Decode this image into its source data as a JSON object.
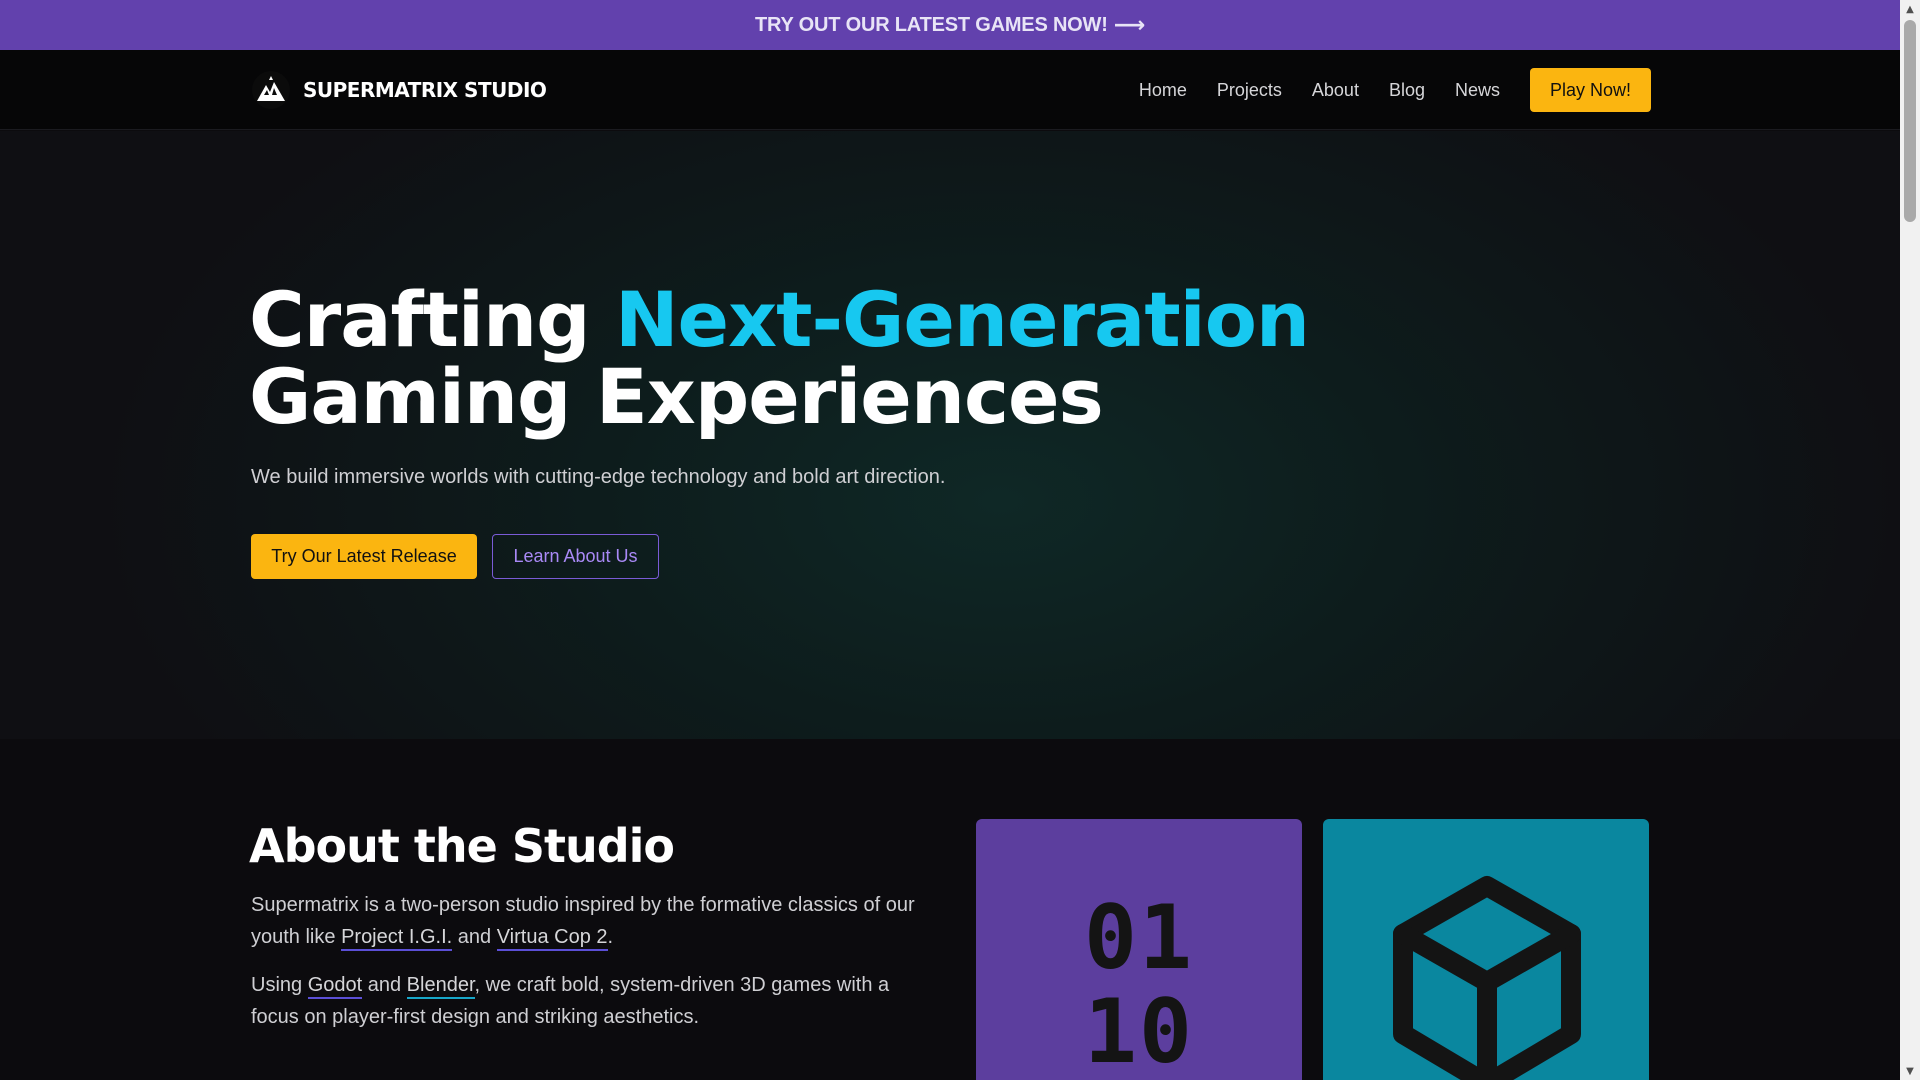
{
  "announcement": {
    "text": "TRY OUT OUR LATEST GAMES NOW!",
    "arrow": "⟶"
  },
  "navbar": {
    "brand": "SUPERMATRIX STUDIO",
    "logo_icon": "mountain-logo-icon",
    "links": [
      "Home",
      "Projects",
      "About",
      "Blog",
      "News"
    ],
    "cta": "Play Now!"
  },
  "hero": {
    "title_start": "Crafting ",
    "title_accent": "Next-Generation",
    "title_line2": "Gaming Experiences",
    "subtitle": "We build immersive worlds with cutting-edge technology and bold art direction.",
    "primary_button": "Try Our Latest Release",
    "secondary_button": "Learn About Us"
  },
  "about": {
    "title": "About the Studio",
    "p1_start": "Supermatrix is a two-person studio inspired by the formative classics of our youth like ",
    "p1_link1": "Project I.G.I.",
    "p1_mid": " and ",
    "p1_link2": "Virtua Cop 2",
    "p1_end": ".",
    "p2_start": "Using ",
    "p2_link1": "Godot",
    "p2_mid": " and ",
    "p2_link2": "Blender",
    "p2_end": ", we craft bold, system-driven 3D games with a focus on player-first design and striking aesthetics.",
    "binary_line1": "01",
    "binary_line2": "10",
    "cube_icon": "cube-icon"
  },
  "colors": {
    "announcement_bg": "#6241ad",
    "accent_cyan": "#17c8f0",
    "button_yellow": "#fbb510",
    "card_purple": "#5c3e9e",
    "card_teal": "#0a879f"
  }
}
